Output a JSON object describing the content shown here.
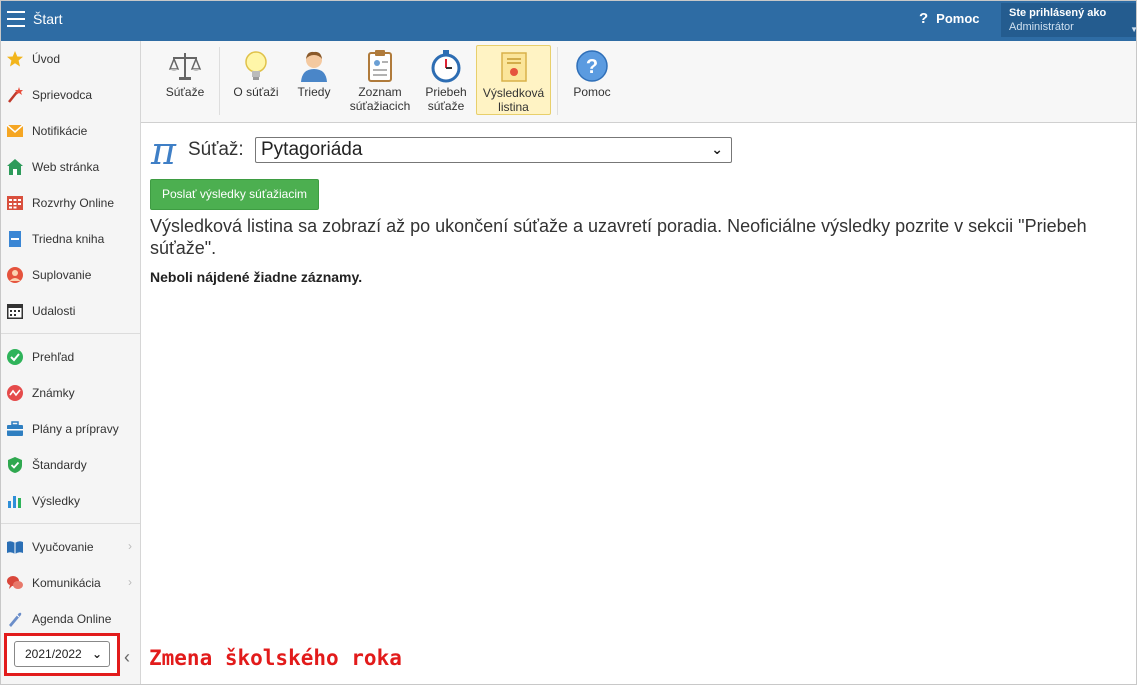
{
  "header": {
    "title": "Štart",
    "help_label": "Pomoc",
    "help_icon": "?",
    "user_line1": "Ste prihlásený ako",
    "user_line2": "Administrátor",
    "bar_color": "#2e6ca4"
  },
  "sidebar": {
    "items": [
      {
        "label": "Úvod",
        "icon": "star-icon"
      },
      {
        "label": "Sprievodca",
        "icon": "wand-icon"
      },
      {
        "label": "Notifikácie",
        "icon": "envelope-icon"
      },
      {
        "label": "Web stránka",
        "icon": "home-icon"
      },
      {
        "label": "Rozvrhy Online",
        "icon": "timetable-icon"
      },
      {
        "label": "Triedna kniha",
        "icon": "book-icon"
      },
      {
        "label": "Suplovanie",
        "icon": "substitute-icon"
      },
      {
        "label": "Udalosti",
        "icon": "calendar-icon"
      },
      {
        "label": "Prehľad",
        "icon": "check-circle-icon"
      },
      {
        "label": "Známky",
        "icon": "grades-icon"
      },
      {
        "label": "Plány a prípravy",
        "icon": "briefcase-icon"
      },
      {
        "label": "Štandardy",
        "icon": "shield-check-icon"
      },
      {
        "label": "Výsledky",
        "icon": "bar-chart-icon"
      },
      {
        "label": "Vyučovanie",
        "icon": "open-book-icon"
      },
      {
        "label": "Komunikácia",
        "icon": "chat-icon"
      },
      {
        "label": "Agenda Online",
        "icon": "pen-icon"
      }
    ],
    "expand_arrow": "›",
    "year": "2021/2022",
    "collapse_arrow": "‹"
  },
  "toolbar": {
    "tools": [
      {
        "label": "Súťaže",
        "icon": "scales-icon"
      },
      {
        "label": "O súťaži",
        "icon": "lightbulb-icon"
      },
      {
        "label": "Triedy",
        "icon": "person-icon"
      },
      {
        "label": "Zoznam súťažiacich",
        "icon": "clipboard-icon"
      },
      {
        "label": "Priebeh súťaže",
        "icon": "stopwatch-icon"
      },
      {
        "label": "Výsledková listina",
        "icon": "certificate-icon"
      },
      {
        "label": "Pomoc",
        "icon": "help-circle-icon"
      }
    ]
  },
  "main": {
    "competition_label": "Súťaž:",
    "competition_value": "Pytagoriáda",
    "send_button": "Poslať výsledky súťažiacim",
    "info_text": "Výsledková listina sa zobrazí až po ukončení súťaže a uzavretí poradia. Neoficiálne výsledky pozrite v sekcii \"Priebeh súťaže\".",
    "empty_text": "Neboli nájdené žiadne záznamy.",
    "pi_symbol": "π"
  },
  "annotation": "Zmena školského roka",
  "colors": {
    "accent": "#2e6ca4",
    "annotation": "#e21b1b",
    "button": "#4caf50"
  }
}
